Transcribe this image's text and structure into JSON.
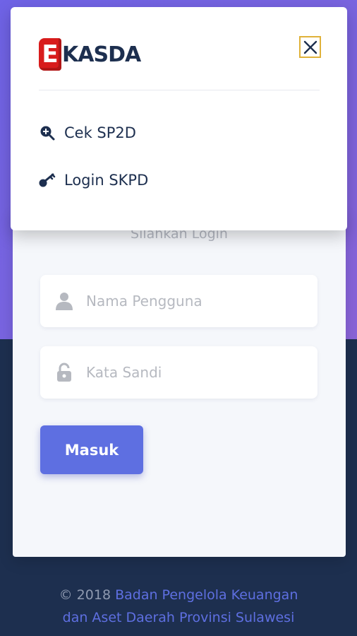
{
  "login": {
    "subtitle": "Silahkan Login",
    "username_placeholder": "Nama Pengguna",
    "password_placeholder": "Kata Sandi",
    "submit_label": "Masuk"
  },
  "footer": {
    "copyright": "© 2018",
    "org_line1": "Badan Pengelola Keuangan",
    "org_line2": "dan Aset Daerah Provinsi Sulawesi"
  },
  "menu": {
    "logo_letter": "E",
    "logo_text": "KASDA",
    "items": [
      {
        "label": "Cek SP2D",
        "icon": "search-plus-icon"
      },
      {
        "label": "Login SKPD",
        "icon": "key-icon"
      }
    ]
  },
  "colors": {
    "accent": "#5e6fe1",
    "gradient_top": "#6f63e6",
    "dark_bg": "#1d2f4f",
    "logo_red": "#d81c1c",
    "close_border": "#e0b23a"
  }
}
